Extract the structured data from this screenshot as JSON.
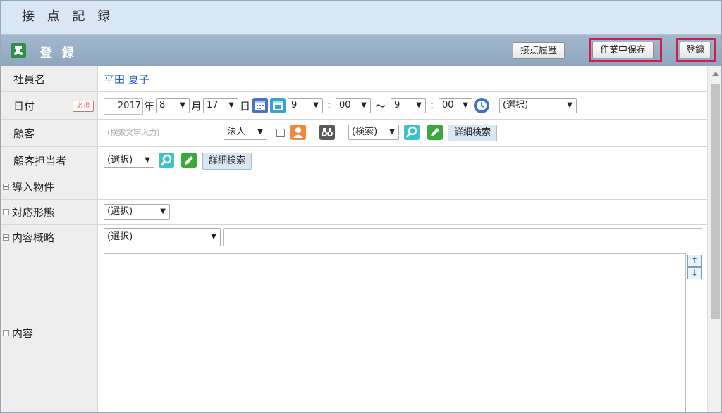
{
  "window": {
    "title": "接 点 記 録"
  },
  "header": {
    "title": "登 録",
    "buttons": {
      "history": "接点履歴",
      "save_draft": "作業中保存",
      "register": "登録"
    }
  },
  "form": {
    "employee": {
      "label": "社員名",
      "value": "平田 夏子"
    },
    "date": {
      "label": "日付",
      "required": "必須",
      "year": "2017",
      "year_unit": "年",
      "month": "8",
      "month_unit": "月",
      "day": "17",
      "day_unit": "日",
      "start_hour": "9",
      "colon": ":",
      "start_min": "00",
      "tilde": "～",
      "end_hour": "9",
      "end_min": "00",
      "select": "(選択)"
    },
    "customer": {
      "label": "顧客",
      "placeholder": "(検索文字入力)",
      "type": "法人",
      "search_select": "(検索)",
      "detail_search": "詳細検索"
    },
    "contact": {
      "label": "顧客担当者",
      "select": "(選択)",
      "detail_search": "詳細検索"
    },
    "product": {
      "label": "導入物件"
    },
    "response": {
      "label": "対応形態",
      "select": "(選択)"
    },
    "summary": {
      "label": "内容概略",
      "select": "(選択)",
      "text": ""
    },
    "content": {
      "label": "内容",
      "text": ""
    }
  },
  "colors": {
    "highlight": "#d0204a",
    "header_bg": "#8ea6bf",
    "topbar_bg": "#d9e6f3",
    "link": "#1f5fbf"
  },
  "icons": [
    "app-icon",
    "calendar-icon",
    "clock-icon",
    "person-icon",
    "binoculars-icon",
    "search-icon",
    "pencil-icon"
  ]
}
